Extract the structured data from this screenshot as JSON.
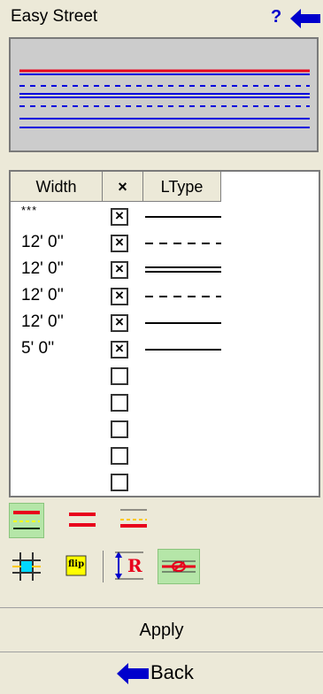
{
  "header": {
    "title": "Easy Street",
    "help_label": "?"
  },
  "grid": {
    "columns": [
      "Width",
      "×",
      "LType"
    ],
    "rows": [
      {
        "width": "***",
        "checked": true,
        "ltype": "solid"
      },
      {
        "width": "12' 0''",
        "checked": true,
        "ltype": "dashed"
      },
      {
        "width": "12' 0''",
        "checked": true,
        "ltype": "double"
      },
      {
        "width": "12' 0''",
        "checked": true,
        "ltype": "dashed"
      },
      {
        "width": "12' 0''",
        "checked": true,
        "ltype": "solid"
      },
      {
        "width": "5' 0''",
        "checked": true,
        "ltype": "solid"
      },
      {
        "width": "",
        "checked": false,
        "ltype": ""
      },
      {
        "width": "",
        "checked": false,
        "ltype": ""
      },
      {
        "width": "",
        "checked": false,
        "ltype": ""
      },
      {
        "width": "",
        "checked": false,
        "ltype": ""
      },
      {
        "width": "",
        "checked": false,
        "ltype": ""
      }
    ],
    "check_mark": "×"
  },
  "toolbar": {
    "flip_label": "flip",
    "r_label": "R"
  },
  "footer": {
    "apply_label": "Apply",
    "back_label": "Back"
  },
  "colors": {
    "red": "#e8001c",
    "blue": "#0000dd",
    "yellow": "#ffff00",
    "active": "#b5e6a8"
  }
}
